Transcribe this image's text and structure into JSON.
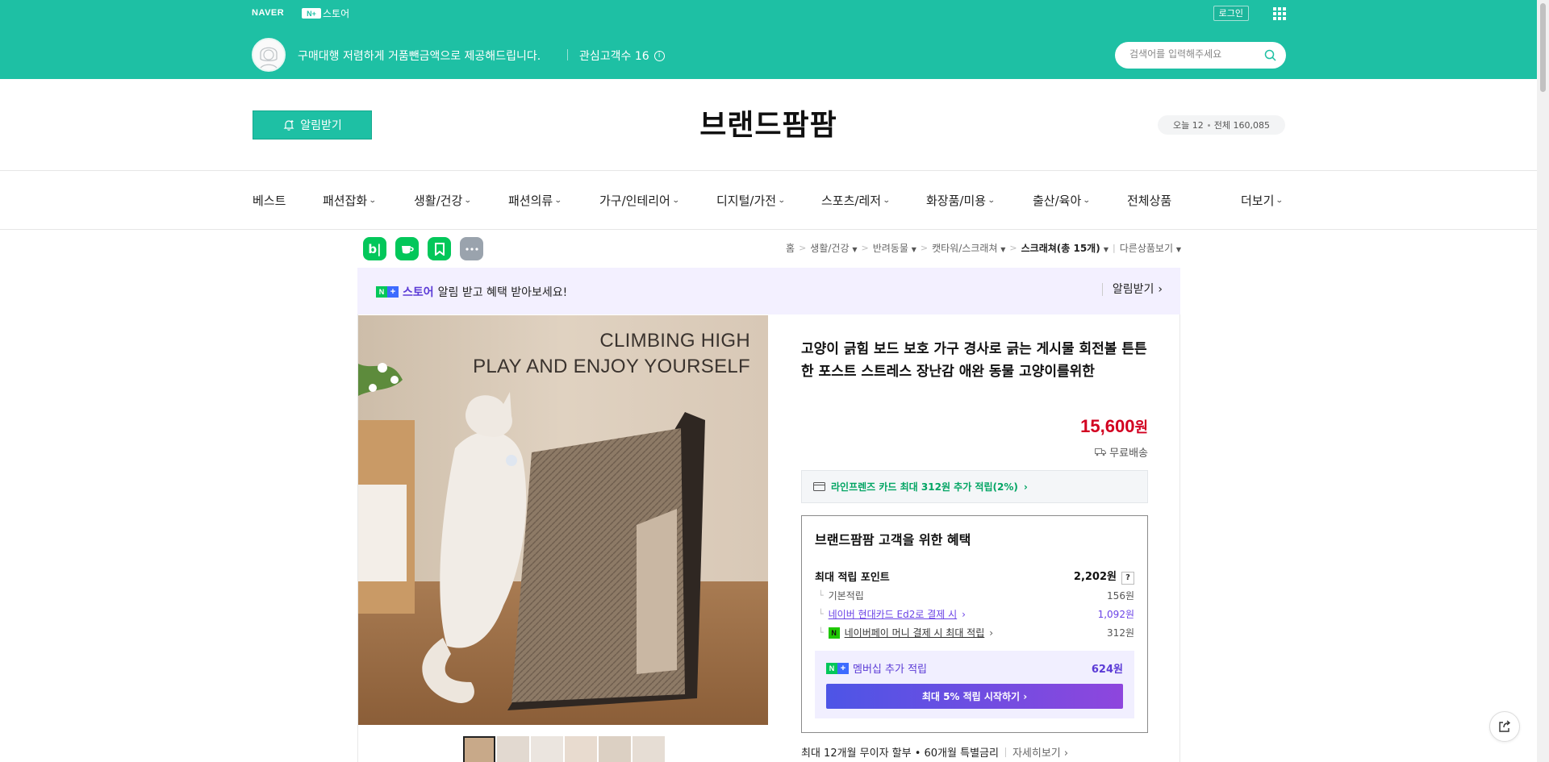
{
  "topbar": {
    "naver_logo": "NAVER",
    "store_text": "스토어",
    "login": "로그인",
    "store_desc": "구매대행 저렴하게 거품뺀금액으로 제공해드립니다.",
    "interest_label": "관심고객수 16",
    "search_placeholder": "검색어를 입력해주세요"
  },
  "header": {
    "alarm_label": "알림받기",
    "brand": "브랜드팜팜",
    "visits_today": "오늘 12",
    "visits_total": "전체 160,085"
  },
  "nav": {
    "items": [
      "베스트",
      "패션잡화",
      "생활/건강",
      "패션의류",
      "가구/인테리어",
      "디지털/가전",
      "스포츠/레저",
      "화장품/미용",
      "출산/육아",
      "전체상품"
    ],
    "more": "더보기"
  },
  "breadcrumb": {
    "items": [
      "홈",
      "생활/건강",
      "반려동물",
      "캣타워/스크래쳐",
      "스크래쳐(총 15개)",
      "다른상품보기"
    ]
  },
  "promo": {
    "store": "스토어",
    "text": "알림 받고 혜택 받아보세요!",
    "action": "알림받기"
  },
  "product": {
    "image_text_1": "CLIMBING HIGH",
    "image_text_2": "PLAY AND ENJOY YOURSELF",
    "title": "고양이 긁힘 보드 보호 가구 경사로 긁는 게시물 회전볼 튼튼한 포스트 스트레스 장난감 애완 동물 고양이를위한",
    "price": "15,600",
    "price_unit": "원",
    "delivery": "무료배송",
    "card_banner": "라인프렌즈 카드 최대 312원 추가 적립(2%)",
    "installment": "최대 12개월 무이자 할부 • 60개월 특별금리",
    "installment_more": "자세히보기"
  },
  "benefit": {
    "title": "브랜드팜팜 고객을 위한 혜택",
    "max_label": "최대 적립 포인트",
    "max_value": "2,202원",
    "rows": [
      {
        "label": "기본적립",
        "value": "156원"
      },
      {
        "label": "네이버 현대카드 Ed2로 결제 시",
        "value": "1,092원"
      },
      {
        "label": "네이버페이 머니 결제 시 최대 적립",
        "value": "312원"
      }
    ],
    "member_label": "멤버십 추가 적립",
    "member_value": "624원",
    "member_button": "최대 5% 적립 시작하기"
  },
  "colors": {
    "brand_green": "#1ec0a4",
    "price_red": "#d20020",
    "purple": "#6a42e6"
  }
}
